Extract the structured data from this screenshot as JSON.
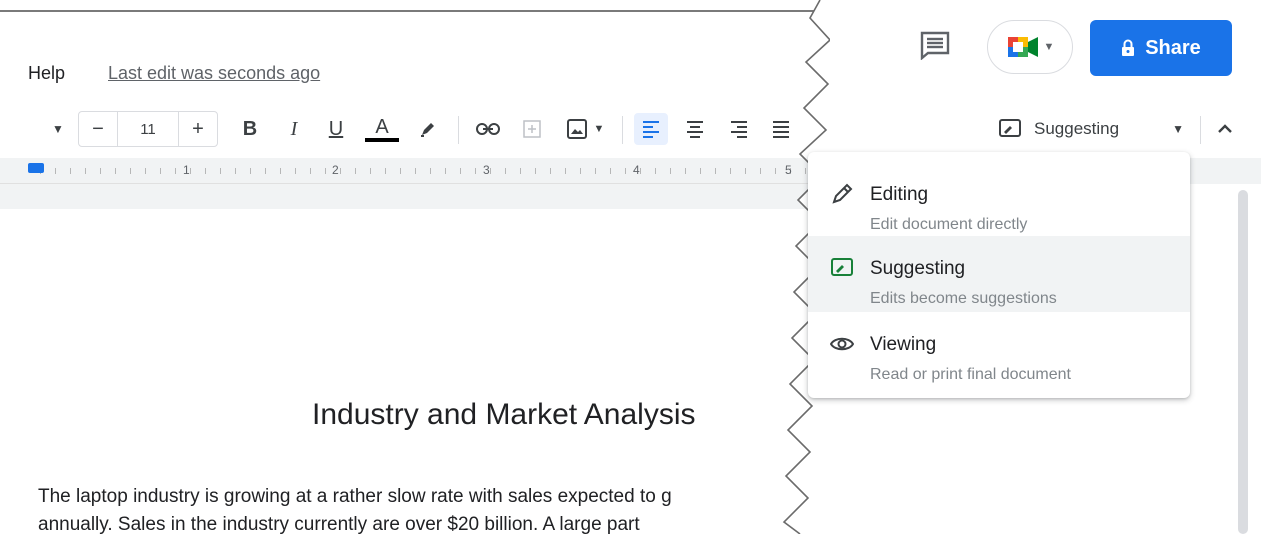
{
  "header": {
    "menu_help": "Help",
    "last_edit": "Last edit was seconds ago"
  },
  "toolbar": {
    "font_size": "11",
    "minus": "−",
    "plus": "+",
    "bold": "B",
    "italic": "I",
    "underline": "U",
    "text_color": "A"
  },
  "ruler": {
    "numbers": [
      "1",
      "2",
      "3",
      "4",
      "5"
    ]
  },
  "document": {
    "title": "Industry and Market Analysis",
    "line1": "The laptop industry is growing at a rather slow rate with sales expected to g",
    "line2": "annually.  Sales in the industry currently are over $20 billion.  A large part"
  },
  "share": {
    "label": "Share"
  },
  "mode_select": {
    "current": "Suggesting"
  },
  "mode_menu": {
    "items": [
      {
        "title": "Editing",
        "desc": "Edit document directly",
        "icon": "pencil-icon"
      },
      {
        "title": "Suggesting",
        "desc": "Edits become suggestions",
        "icon": "suggest-icon"
      },
      {
        "title": "Viewing",
        "desc": "Read or print final document",
        "icon": "eye-icon"
      }
    ]
  },
  "colors": {
    "accent": "#1a73e8",
    "suggest_green": "#188038",
    "menu_hover": "#f1f3f4"
  }
}
